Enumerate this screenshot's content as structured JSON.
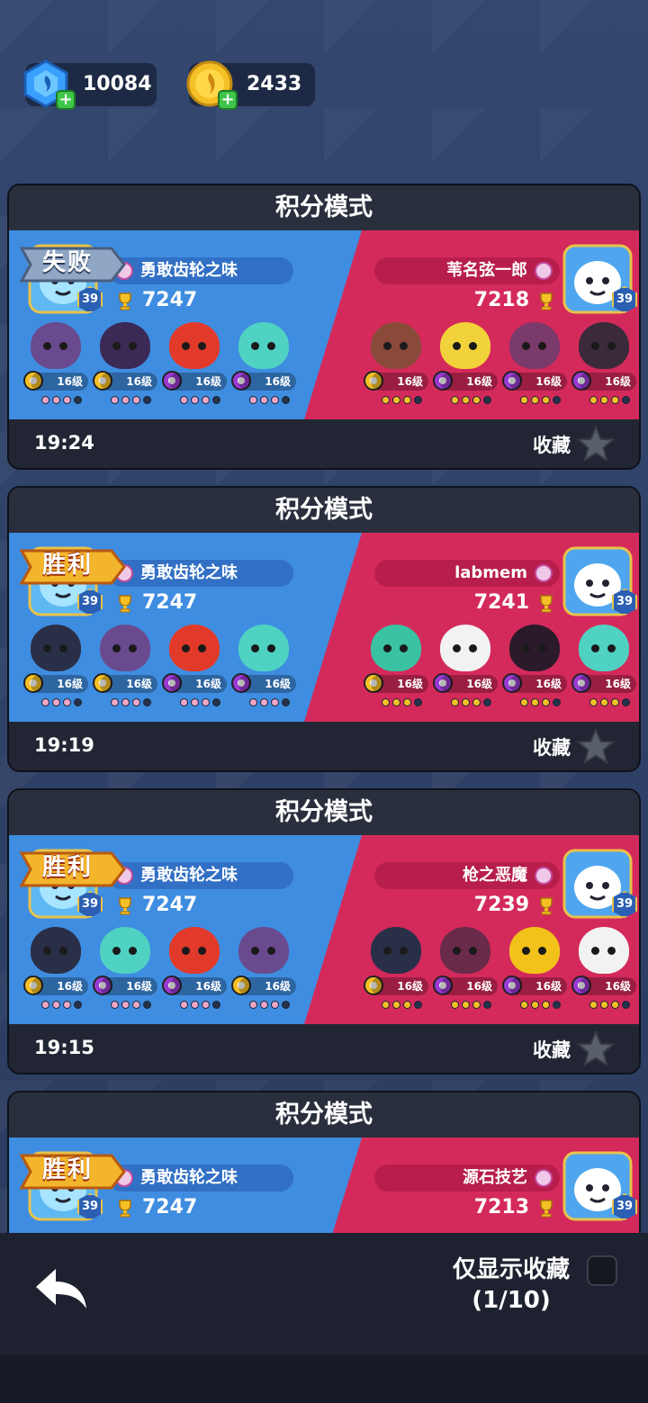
{
  "currency": {
    "gems": "10084",
    "coins": "2433"
  },
  "colors": {
    "blue_team": "#3f8de0",
    "red_team": "#d42a5b",
    "win_badge": "#f3b52b",
    "lose_badge": "#8fa6c4"
  },
  "matches": [
    {
      "mode": "积分模式",
      "result": "失败",
      "left": {
        "name": "勇敢齿轮之味",
        "score": "7247",
        "level": "39"
      },
      "right": {
        "name": "苇名弦一郎",
        "score": "7218",
        "level": "39"
      },
      "left_brawler_levels": [
        "16级",
        "16级",
        "16级",
        "16级"
      ],
      "right_brawler_levels": [
        "16级",
        "16级",
        "16级",
        "16级"
      ],
      "time": "19:24",
      "fav_label": "收藏"
    },
    {
      "mode": "积分模式",
      "result": "胜利",
      "left": {
        "name": "勇敢齿轮之味",
        "score": "7247",
        "level": "39"
      },
      "right": {
        "name": "labmem",
        "score": "7241",
        "level": "39"
      },
      "left_brawler_levels": [
        "16级",
        "16级",
        "16级",
        "16级"
      ],
      "right_brawler_levels": [
        "16级",
        "16级",
        "16级",
        "16级"
      ],
      "time": "19:19",
      "fav_label": "收藏"
    },
    {
      "mode": "积分模式",
      "result": "胜利",
      "left": {
        "name": "勇敢齿轮之味",
        "score": "7247",
        "level": "39"
      },
      "right": {
        "name": "枪之恶魔",
        "score": "7239",
        "level": "39"
      },
      "left_brawler_levels": [
        "16级",
        "16级",
        "16级",
        "16级"
      ],
      "right_brawler_levels": [
        "16级",
        "16级",
        "16级",
        "16级"
      ],
      "time": "19:15",
      "fav_label": "收藏"
    },
    {
      "mode": "积分模式",
      "result": "胜利",
      "left": {
        "name": "勇敢齿轮之味",
        "score": "7247",
        "level": "39"
      },
      "right": {
        "name": "源石技艺",
        "score": "7213",
        "level": "39"
      }
    }
  ],
  "bottom": {
    "only_fav_label": "仅显示收藏",
    "page_count": "(1/10)"
  }
}
